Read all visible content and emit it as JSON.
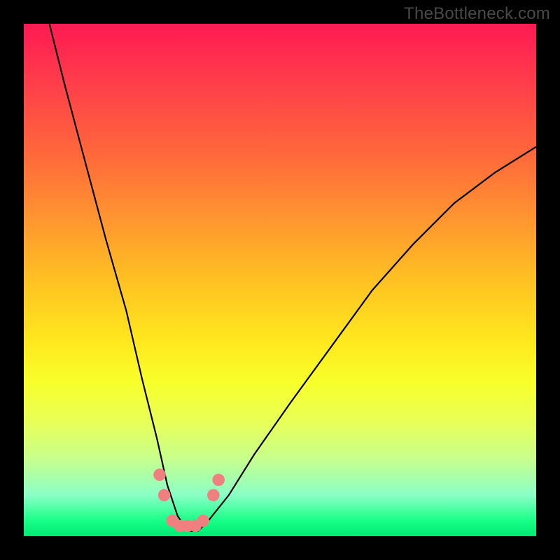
{
  "watermark": "TheBottleneck.com",
  "chart_data": {
    "type": "line",
    "title": "",
    "xlabel": "",
    "ylabel": "",
    "xlim": [
      0,
      100
    ],
    "ylim": [
      0,
      100
    ],
    "gradient_stops": [
      {
        "pos": 0,
        "color": "#ff1a53"
      },
      {
        "pos": 12,
        "color": "#ff3f4a"
      },
      {
        "pos": 26,
        "color": "#ff6a3a"
      },
      {
        "pos": 38,
        "color": "#ff9530"
      },
      {
        "pos": 50,
        "color": "#ffc122"
      },
      {
        "pos": 62,
        "color": "#ffe81e"
      },
      {
        "pos": 70,
        "color": "#f8ff2a"
      },
      {
        "pos": 78,
        "color": "#e7ff59"
      },
      {
        "pos": 85,
        "color": "#c6ff8e"
      },
      {
        "pos": 92,
        "color": "#8affc6"
      },
      {
        "pos": 97,
        "color": "#18ff87"
      },
      {
        "pos": 100,
        "color": "#00e873"
      }
    ],
    "series": [
      {
        "name": "curve",
        "x": [
          5,
          8,
          12,
          16,
          20,
          23,
          26,
          28,
          30,
          32,
          34,
          36,
          40,
          45,
          52,
          60,
          68,
          76,
          84,
          92,
          100
        ],
        "y": [
          100,
          88,
          73,
          58,
          44,
          31,
          19,
          10,
          4,
          1,
          1,
          3,
          8,
          16,
          26,
          37,
          48,
          57,
          65,
          71,
          76
        ]
      }
    ],
    "markers": [
      {
        "x": 26.5,
        "y": 12,
        "r": 1.2,
        "color": "#f08080"
      },
      {
        "x": 27.4,
        "y": 8,
        "r": 1.2,
        "color": "#f08080"
      },
      {
        "x": 29.0,
        "y": 3,
        "r": 1.2,
        "color": "#f08080"
      },
      {
        "x": 30.5,
        "y": 2,
        "r": 1.2,
        "color": "#f08080"
      },
      {
        "x": 32.0,
        "y": 2,
        "r": 1.2,
        "color": "#f08080"
      },
      {
        "x": 33.5,
        "y": 2,
        "r": 1.2,
        "color": "#f08080"
      },
      {
        "x": 35.0,
        "y": 3,
        "r": 1.2,
        "color": "#f08080"
      },
      {
        "x": 37.0,
        "y": 8,
        "r": 1.2,
        "color": "#f08080"
      },
      {
        "x": 38.0,
        "y": 11,
        "r": 1.2,
        "color": "#f08080"
      }
    ]
  }
}
